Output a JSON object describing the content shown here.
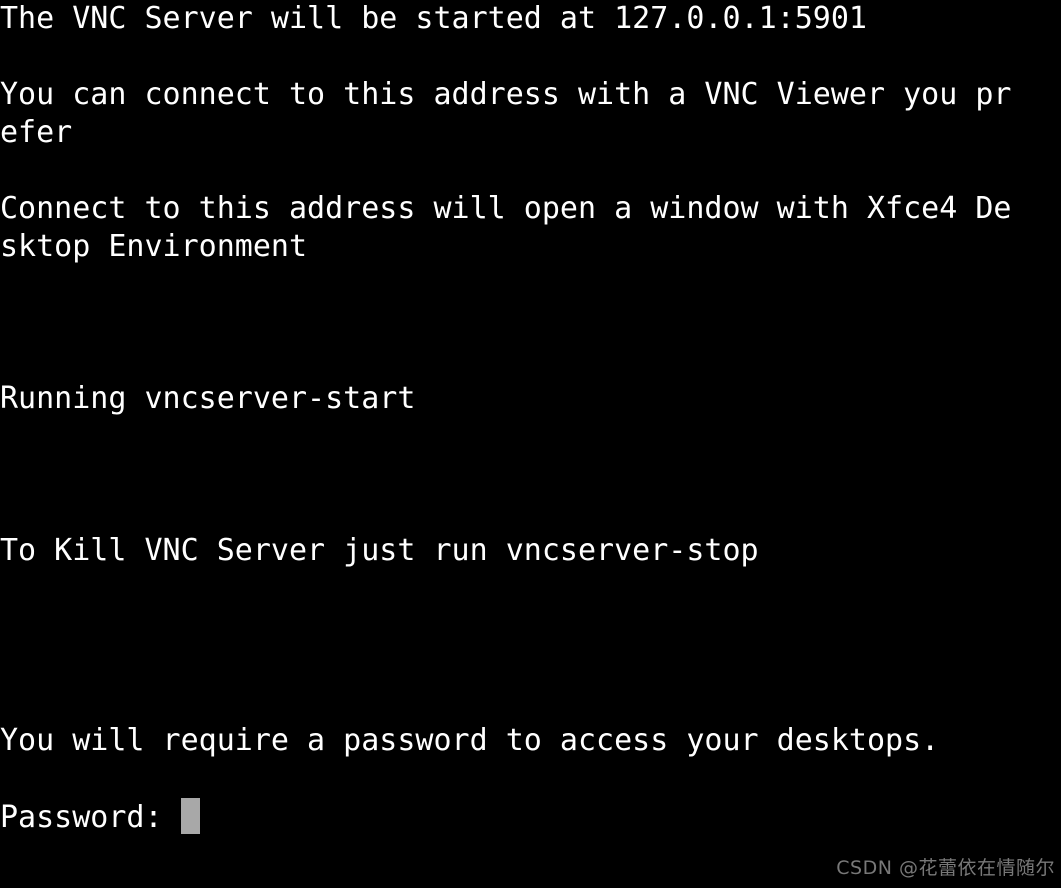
{
  "terminal": {
    "background_color": "#000000",
    "foreground_color": "#ffffff",
    "cursor_color": "#a8a8a8",
    "lines": [
      "The VNC Server will be started at 127.0.0.1:5901",
      "",
      "You can connect to this address with a VNC Viewer you pr",
      "efer",
      "",
      "Connect to this address will open a window with Xfce4 De",
      "sktop Environment",
      "",
      "",
      "",
      "Running vncserver-start",
      "",
      "",
      "",
      "To Kill VNC Server just run vncserver-stop",
      "",
      "",
      "",
      "",
      "You will require a password to access your desktops."
    ],
    "prompt_label": "Password: ",
    "prompt_value": ""
  },
  "watermark": {
    "text": "CSDN @花蕾依在情随尔",
    "color": "#8d8d8d"
  }
}
